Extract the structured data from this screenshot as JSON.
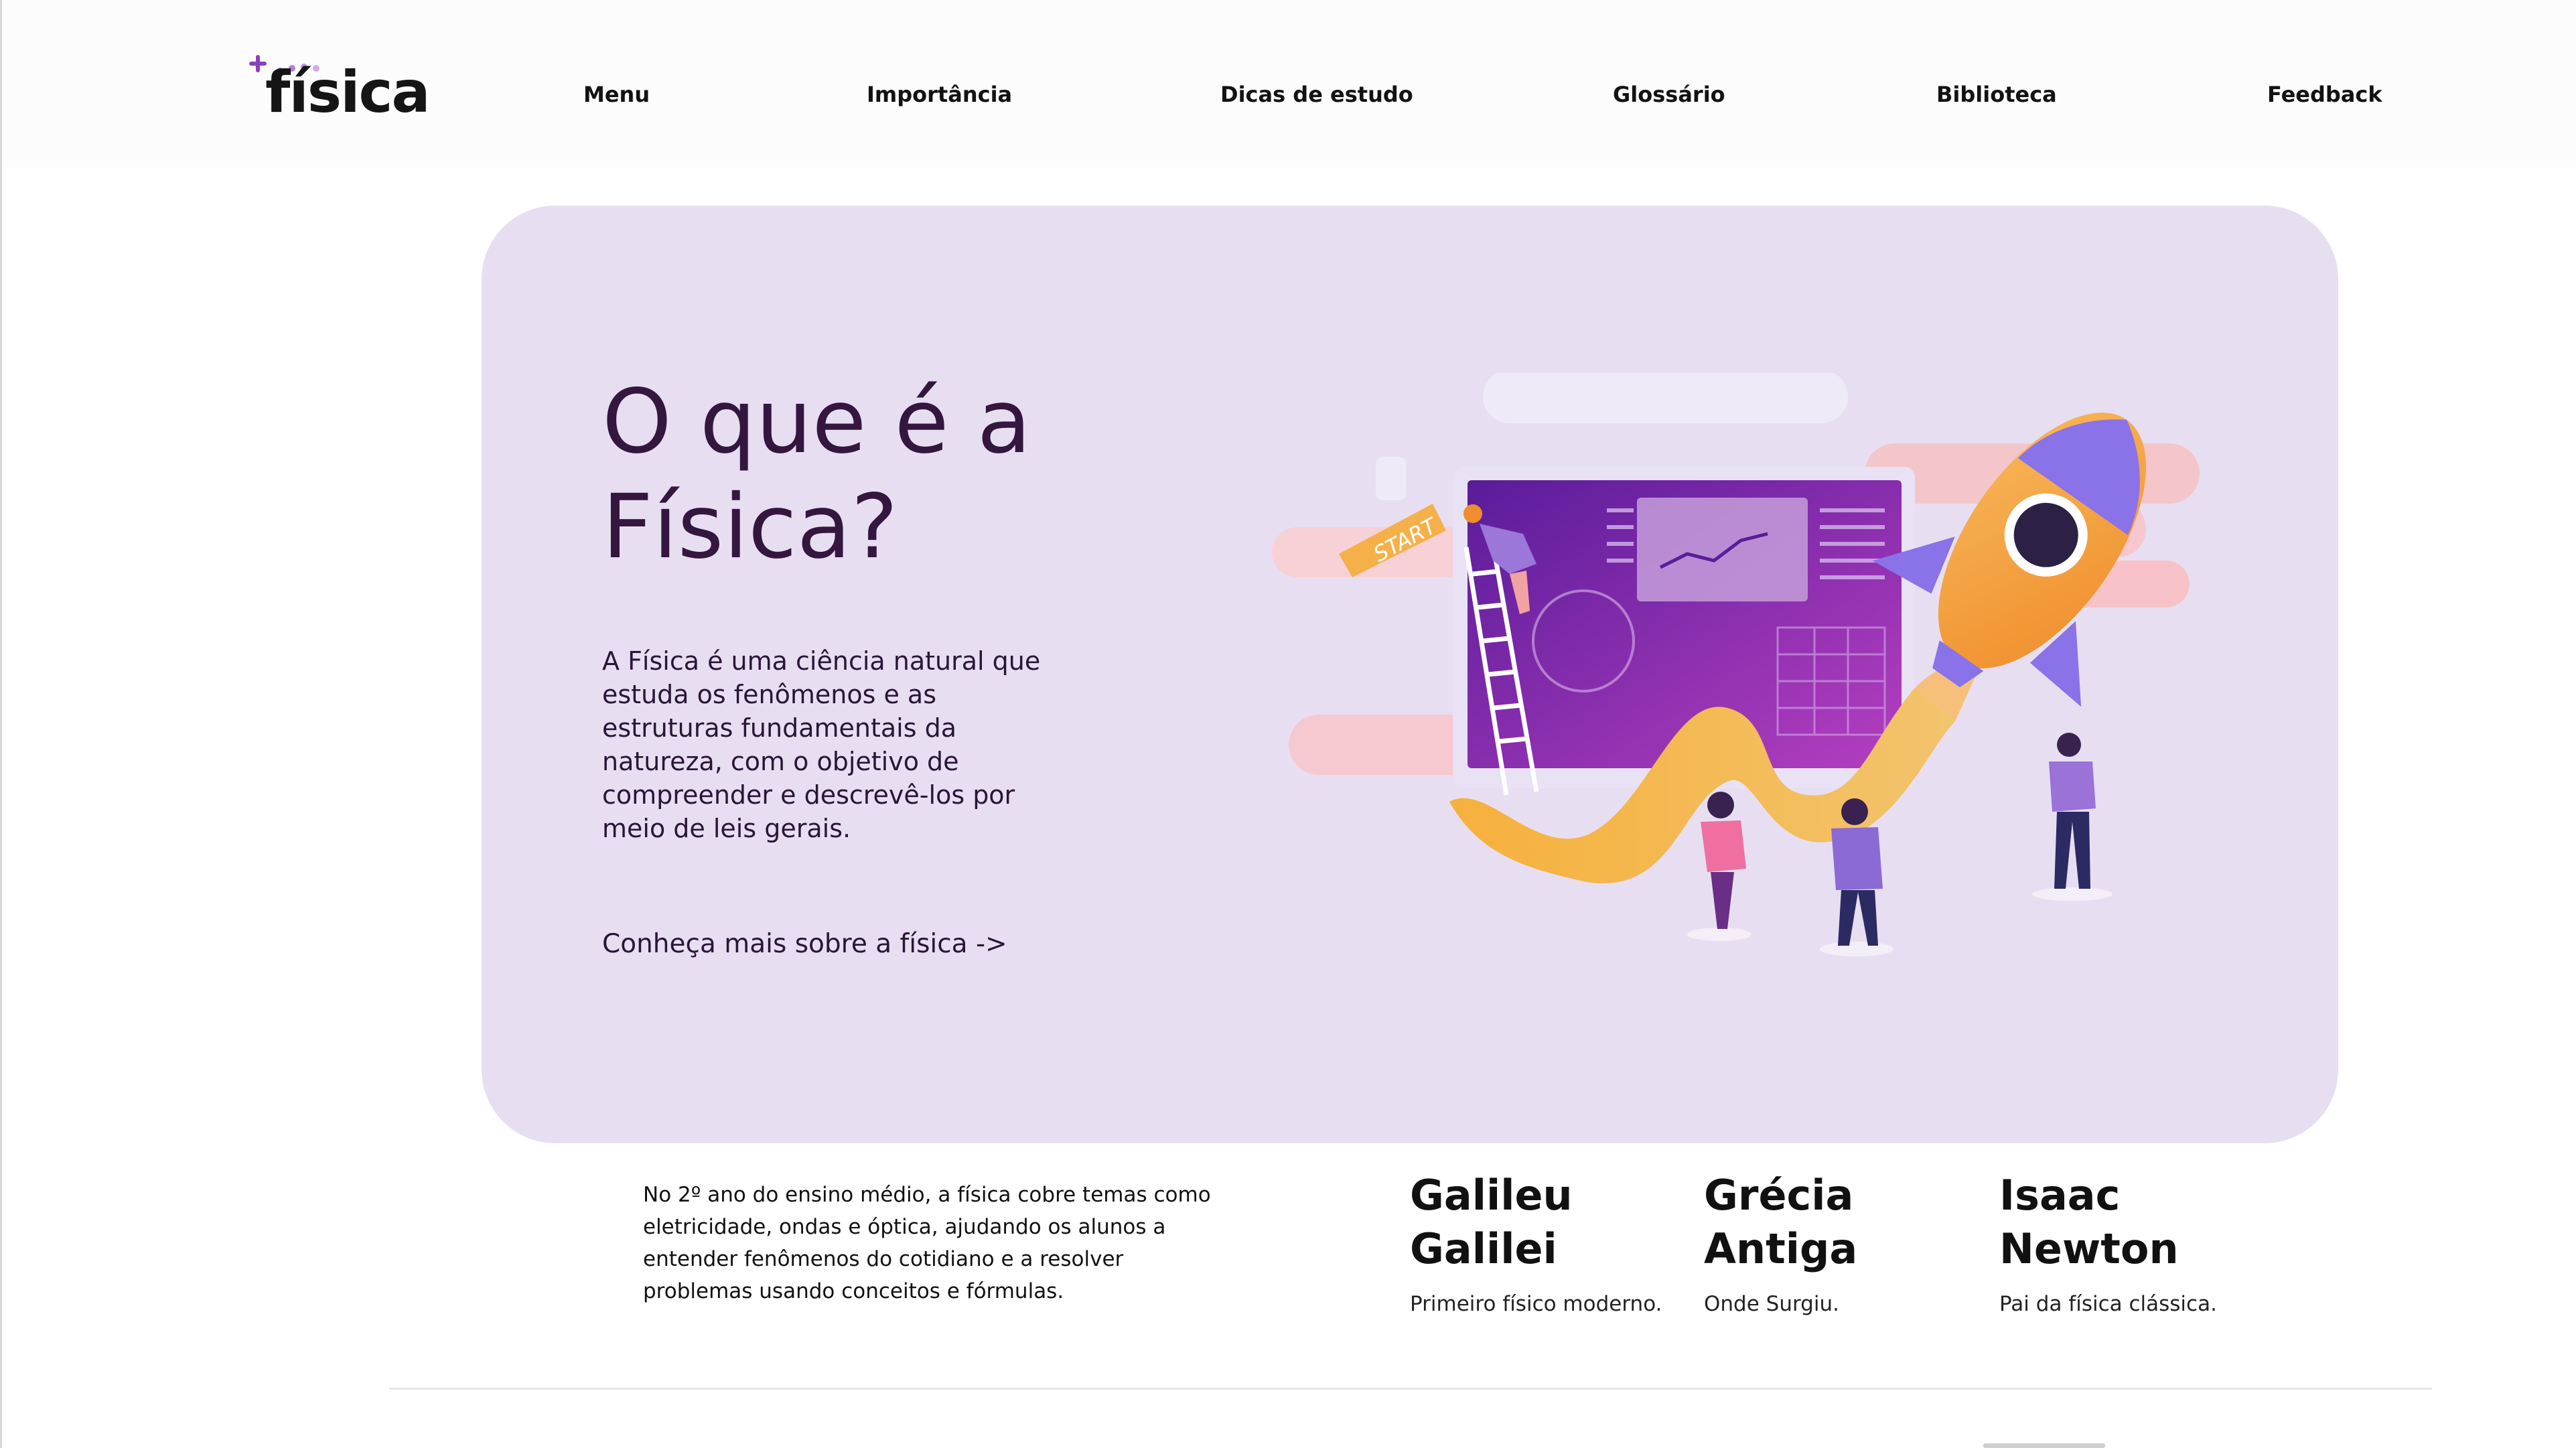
{
  "header": {
    "logo_text": "física",
    "nav": [
      "Menu",
      "Importância",
      "Dicas de estudo",
      "Glossário",
      "Biblioteca",
      "Feedback"
    ]
  },
  "hero": {
    "title_line1": "O que é a",
    "title_line2": "Física?",
    "description": "A Física é uma ciência natural que estuda os fenômenos e as estruturas fundamentais da natureza, com o objetivo de compreender e descrevê-los por meio de leis gerais.",
    "link": "Conheça mais sobre a física ->",
    "illustration_sign": "START"
  },
  "intro": {
    "text": "No 2º ano do ensino médio, a física cobre temas como eletricidade, ondas e óptica, ajudando os alunos a entender fenômenos do cotidiano e a resolver problemas usando conceitos e fórmulas."
  },
  "facts": [
    {
      "title_line1": "Galileu",
      "title_line2": "Galilei",
      "subtitle": "Primeiro físico moderno."
    },
    {
      "title_line1": "Grécia",
      "title_line2": "Antiga",
      "subtitle": "Onde Surgiu."
    },
    {
      "title_line1": "Isaac",
      "title_line2": "Newton",
      "subtitle": "Pai da física clássica."
    }
  ],
  "colors": {
    "hero_bg": "#e7dff1",
    "title": "#34163f",
    "accent_purple": "#8a3fc0",
    "accent_orange": "#f4a93a"
  }
}
